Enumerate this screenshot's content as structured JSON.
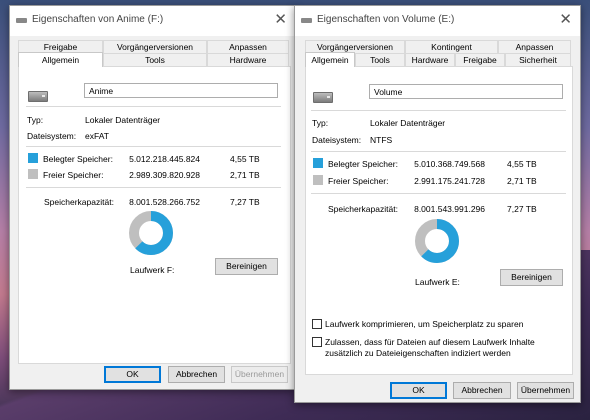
{
  "colors": {
    "used": "#26a0da",
    "free": "#bfbfbf"
  },
  "left": {
    "title": "Eigenschaften von Anime (F:)",
    "tabs_row1": [
      "Freigabe",
      "Vorgängerversionen",
      "Anpassen"
    ],
    "tabs_row2": [
      "Allgemein",
      "Tools",
      "Hardware"
    ],
    "active_tab": "Allgemein",
    "name": "Anime",
    "type_label": "Typ:",
    "type_value": "Lokaler Datenträger",
    "fs_label": "Dateisystem:",
    "fs_value": "exFAT",
    "used_label": "Belegter Speicher:",
    "used_bytes": "5.012.218.445.824",
    "used_size": "4,55 TB",
    "free_label": "Freier Speicher:",
    "free_bytes": "2.989.309.820.928",
    "free_size": "2,71 TB",
    "cap_label": "Speicherkapazität:",
    "cap_bytes": "8.001.528.266.752",
    "cap_size": "7,27 TB",
    "used_fraction": 0.626,
    "drive_label": "Laufwerk F:",
    "cleanup_button": "Bereinigen",
    "ok": "OK",
    "cancel": "Abbrechen",
    "apply": "Übernehmen"
  },
  "right": {
    "title": "Eigenschaften von Volume (E:)",
    "tabs_row1": [
      "Vorgängerversionen",
      "Kontingent",
      "Anpassen"
    ],
    "tabs_row2": [
      "Allgemein",
      "Tools",
      "Hardware",
      "Freigabe",
      "Sicherheit"
    ],
    "active_tab": "Allgemein",
    "name": "Volume",
    "type_label": "Typ:",
    "type_value": "Lokaler Datenträger",
    "fs_label": "Dateisystem:",
    "fs_value": "NTFS",
    "used_label": "Belegter Speicher:",
    "used_bytes": "5.010.368.749.568",
    "used_size": "4,55 TB",
    "free_label": "Freier Speicher:",
    "free_bytes": "2.991.175.241.728",
    "free_size": "2,71 TB",
    "cap_label": "Speicherkapazität:",
    "cap_bytes": "8.001.543.991.296",
    "cap_size": "7,27 TB",
    "used_fraction": 0.626,
    "drive_label": "Laufwerk E:",
    "cleanup_button": "Bereinigen",
    "compress_label": "Laufwerk komprimieren, um Speicherplatz zu sparen",
    "index_label_1": "Zulassen, dass für Dateien auf diesem Laufwerk Inhalte",
    "index_label_2": "zusätzlich zu Dateieigenschaften indiziert werden",
    "ok": "OK",
    "cancel": "Abbrechen",
    "apply": "Übernehmen"
  }
}
